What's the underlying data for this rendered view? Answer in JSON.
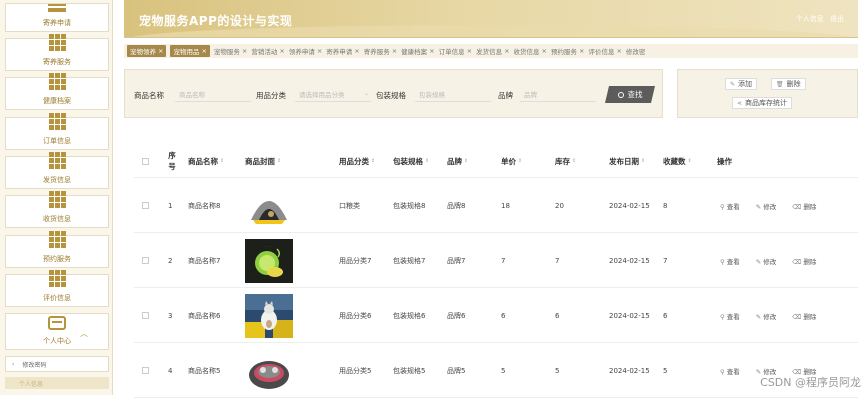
{
  "header": {
    "title": "宠物服务APP的设计与实现",
    "personal_info": "个人信息",
    "logout": "退出"
  },
  "sidebar": {
    "items": [
      {
        "label": "寄养申请",
        "icon": "menu-icon"
      },
      {
        "label": "寄养服务",
        "icon": "grid-icon"
      },
      {
        "label": "健康档案",
        "icon": "grid-icon"
      },
      {
        "label": "订单信息",
        "icon": "grid-icon"
      },
      {
        "label": "发货信息",
        "icon": "grid-icon"
      },
      {
        "label": "收货信息",
        "icon": "grid-icon"
      },
      {
        "label": "预约服务",
        "icon": "grid-icon"
      },
      {
        "label": "评价信息",
        "icon": "grid-icon"
      },
      {
        "label": "个人中心",
        "icon": "personal-icon"
      }
    ],
    "sub_items": [
      {
        "label": "修改密码"
      },
      {
        "label": "个人信息"
      }
    ]
  },
  "tabs": [
    {
      "label": "宠物领养",
      "active": true
    },
    {
      "label": "宠物用品",
      "active": true
    },
    {
      "label": "宠物服务",
      "active": false
    },
    {
      "label": "营销活动",
      "active": false
    },
    {
      "label": "领养申请",
      "active": false
    },
    {
      "label": "寄养申请",
      "active": false
    },
    {
      "label": "寄养服务",
      "active": false
    },
    {
      "label": "健康档案",
      "active": false
    },
    {
      "label": "订单信息",
      "active": false
    },
    {
      "label": "发货信息",
      "active": false
    },
    {
      "label": "收货信息",
      "active": false
    },
    {
      "label": "预约服务",
      "active": false
    },
    {
      "label": "评价信息",
      "active": false
    },
    {
      "label": "修改密",
      "active": false
    }
  ],
  "tab_close": "×",
  "search": {
    "name_label": "商品名称",
    "name_placeholder": "商品名称",
    "category_label": "用品分类",
    "category_placeholder": "请选择用品分类",
    "spec_label": "包装规格",
    "spec_placeholder": "包装规格",
    "brand_label": "品牌",
    "brand_placeholder": "品牌",
    "button": "查找"
  },
  "actions": {
    "add": "添加",
    "delete": "删除",
    "stats": "商品库存统计"
  },
  "table": {
    "columns": {
      "index": "序号",
      "name": "商品名称",
      "cover": "商品封面",
      "category": "用品分类",
      "spec": "包装规格",
      "brand": "品牌",
      "price": "单价",
      "stock": "库存",
      "date": "发布日期",
      "favorites": "收藏数",
      "ops": "操作"
    },
    "ops": {
      "view": "查看",
      "edit": "修改",
      "delete": "删除"
    },
    "rows": [
      {
        "index": "1",
        "name": "商品名称8",
        "category": "口粮类",
        "spec": "包装规格8",
        "brand": "品牌8",
        "price": "18",
        "stock": "20",
        "date": "2024-02-15",
        "favorites": "8",
        "thumb": "cat-tent"
      },
      {
        "index": "2",
        "name": "商品名称7",
        "category": "用品分类7",
        "spec": "包装规格7",
        "brand": "品牌7",
        "price": "7",
        "stock": "7",
        "date": "2024-02-15",
        "favorites": "7",
        "thumb": "pet-bowl"
      },
      {
        "index": "3",
        "name": "商品名称6",
        "category": "用品分类6",
        "spec": "包装规格6",
        "brand": "品牌6",
        "price": "6",
        "stock": "6",
        "date": "2024-02-15",
        "favorites": "6",
        "thumb": "cat-photo"
      },
      {
        "index": "4",
        "name": "商品名称5",
        "category": "用品分类5",
        "spec": "包装规格5",
        "brand": "品牌5",
        "price": "5",
        "stock": "5",
        "date": "2024-02-15",
        "favorites": "5",
        "thumb": "pet-bed"
      }
    ]
  },
  "watermark": "CSDN @程序员阿龙",
  "colors": {
    "accent": "#b5943d",
    "header": "#d8c27e",
    "active_tab": "#a6894a",
    "search_button": "#5c5c5c"
  }
}
